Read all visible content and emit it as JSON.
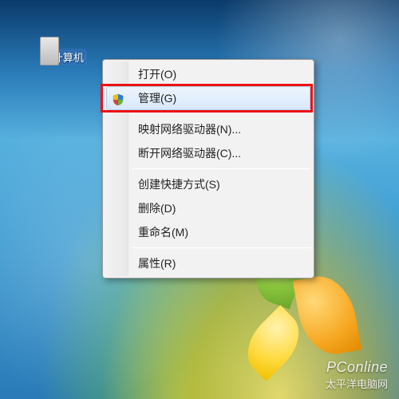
{
  "desktop": {
    "computer_icon_label": "计算机"
  },
  "context_menu": {
    "items": {
      "open": "打开(O)",
      "manage": "管理(G)",
      "map_drive": "映射网络驱动器(N)...",
      "disconnect_drive": "断开网络驱动器(C)...",
      "create_shortcut": "创建快捷方式(S)",
      "delete": "删除(D)",
      "rename": "重命名(M)",
      "properties": "属性(R)"
    },
    "hovered": "manage",
    "highlighted": "manage"
  },
  "watermark": {
    "line1": "PConline",
    "line2": "太平洋电脑网"
  },
  "colors": {
    "highlight_border": "#e11",
    "menu_hover_border": "#aecff7"
  }
}
